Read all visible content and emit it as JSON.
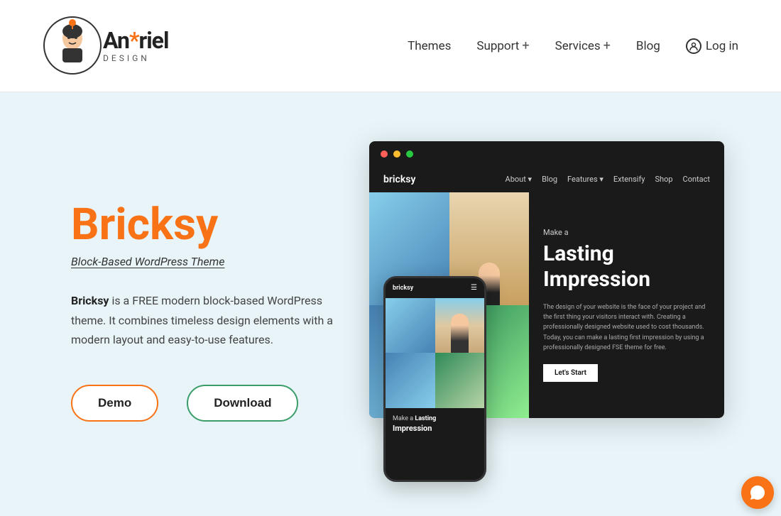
{
  "header": {
    "logo": {
      "name": "Anariel",
      "design_suffix": "DESIGN",
      "alt": "Anariel Design Logo"
    },
    "nav": {
      "themes_label": "Themes",
      "support_label": "Support",
      "support_plus": "+",
      "services_label": "Services",
      "services_plus": "+",
      "blog_label": "Blog",
      "login_label": "Log in"
    }
  },
  "hero": {
    "title": "Bricksy",
    "subtitle": "Block-Based WordPress Theme",
    "description_part1": "Bricksy",
    "description_part2": " is a FREE modern block-based WordPress theme. It combines timeless design elements with a modern layout and easy-to-use features.",
    "btn_demo": "Demo",
    "btn_download": "Download"
  },
  "mockup": {
    "desktop": {
      "nav_logo": "bricksy",
      "nav_links": [
        "About +",
        "Blog",
        "Features +",
        "Extensify",
        "Shop",
        "Contact"
      ],
      "tagline": "Make a",
      "headline_bold": "Lasting Impression",
      "body_text": "The design of your website is the face of your project and the first thing your visitors interact with. Creating a professionally designed website used to cost thousands. Today, you can make a lasting first impression by using a professionally designed FSE theme for free.",
      "cta": "Let's Start"
    },
    "mobile": {
      "logo": "bricksy",
      "caption_line1": "Make a",
      "caption_bold": "Lasting",
      "caption_line2": "Impression"
    }
  },
  "chat": {
    "icon": "💬"
  }
}
